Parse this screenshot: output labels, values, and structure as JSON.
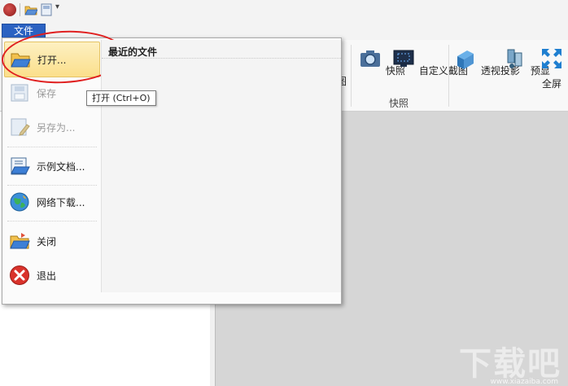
{
  "file_tab": {
    "label": "文件"
  },
  "file_menu": {
    "recent_title": "最近的文件",
    "items": [
      {
        "label": "打开...",
        "icon": "open-folder-icon",
        "enabled": true
      },
      {
        "label": "保存",
        "icon": "save-icon",
        "enabled": false
      },
      {
        "label": "另存为...",
        "icon": "save-as-icon",
        "enabled": false
      },
      {
        "label": "示例文档...",
        "icon": "sample-document-icon",
        "enabled": true
      },
      {
        "label": "网络下载...",
        "icon": "network-download-icon",
        "enabled": true
      },
      {
        "label": "关闭",
        "icon": "close-folder-icon",
        "enabled": true
      },
      {
        "label": "退出",
        "icon": "exit-icon",
        "enabled": true
      }
    ]
  },
  "tooltip": {
    "text": "打开 (Ctrl+O)"
  },
  "ribbon": {
    "partial_label": "图",
    "tools": [
      {
        "label": "快照",
        "icon": "camera-icon"
      },
      {
        "label": "自定义截图",
        "icon": "custom-screenshot-icon"
      },
      {
        "label": "透视投影",
        "icon": "perspective-projection-icon"
      },
      {
        "label": "预显",
        "icon": "preview-icon"
      },
      {
        "label": "全屏",
        "icon": "fullscreen-icon"
      }
    ],
    "group_label": "快照"
  },
  "watermark": {
    "text": "下载吧",
    "sub": "www.xiazaiba.com"
  },
  "colors": {
    "file_tab": "#2b62c2",
    "highlight": "#fbdf8b",
    "annotation": "#e02020"
  }
}
